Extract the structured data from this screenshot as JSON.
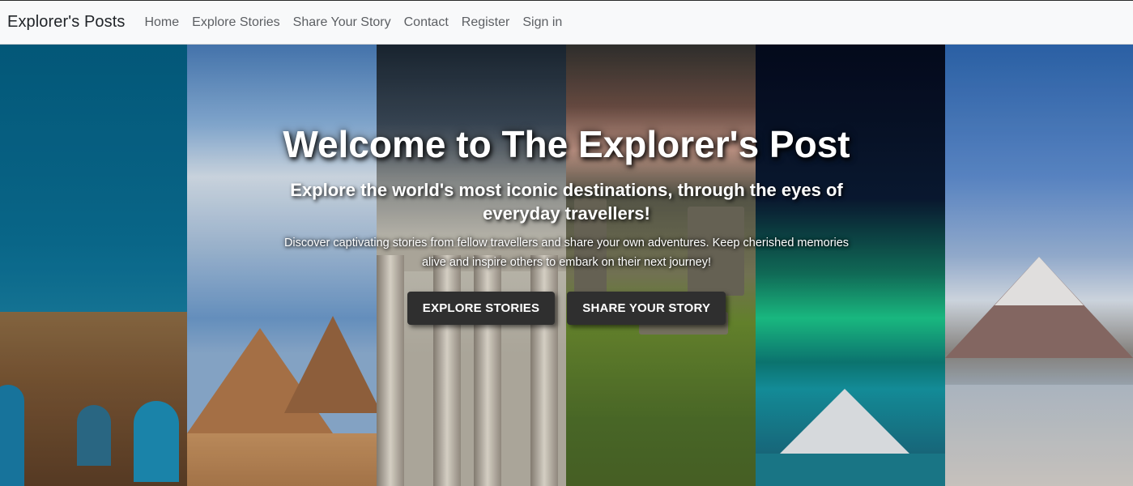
{
  "navbar": {
    "brand": "Explorer's Posts",
    "links": [
      "Home",
      "Explore Stories",
      "Share Your Story",
      "Contact",
      "Register",
      "Sign in"
    ]
  },
  "hero": {
    "title": "Welcome to The Explorer's Post",
    "subtitle": "Explore the world's most iconic destinations, through the eyes of everyday travellers!",
    "description": "Discover captivating stories from fellow travellers and share your own adventures. Keep cherished memories alive and inspire others to embark on their next journey!",
    "buttons": {
      "explore": "EXPLORE STORIES",
      "share": "SHARE YOUR STORY"
    },
    "panels": [
      "colosseum",
      "pyramids",
      "parthenon",
      "stonehenge",
      "aurora",
      "mount-fuji"
    ]
  },
  "colors": {
    "navbar_bg": "#f8f9fa",
    "brand_text": "#212529",
    "nav_link": "#5c5f63",
    "button_bg": "#2f2f2f",
    "hero_text": "#ffffff"
  }
}
